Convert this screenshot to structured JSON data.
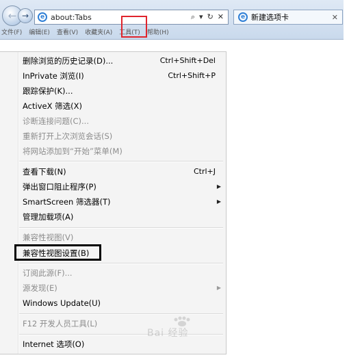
{
  "browser": {
    "address": "about:Tabs",
    "tab_title": "新建选项卡",
    "search_glyph": "⌕",
    "dropdown_glyph": "▾",
    "refresh_glyph": "↻",
    "stop_glyph": "✕",
    "tab_close_glyph": "✕",
    "back_glyph": "←",
    "forward_glyph": "→",
    "ie_glyph": "e"
  },
  "menubar": [
    {
      "label": "文件(F)"
    },
    {
      "label": "编辑(E)"
    },
    {
      "label": "查看(V)"
    },
    {
      "label": "收藏夹(A)"
    },
    {
      "label": "工具(T)"
    },
    {
      "label": "帮助(H)"
    }
  ],
  "tools_menu": {
    "items": [
      {
        "label": "删除浏览的历史记录(D)...",
        "shortcut": "Ctrl+Shift+Del"
      },
      {
        "label": "InPrivate 浏览(I)",
        "shortcut": "Ctrl+Shift+P"
      },
      {
        "label": "跟踪保护(K)..."
      },
      {
        "label": "ActiveX 筛选(X)"
      },
      {
        "label": "诊断连接问题(C)..."
      },
      {
        "label": "重新打开上次浏览会话(S)"
      },
      {
        "label": "将网站添加到“开始”菜单(M)"
      },
      {
        "label": "查看下载(N)",
        "shortcut": "Ctrl+J"
      },
      {
        "label": "弹出窗口阻止程序(P)"
      },
      {
        "label": "SmartScreen 筛选器(T)"
      },
      {
        "label": "管理加载项(A)"
      },
      {
        "label": "兼容性视图(V)"
      },
      {
        "label": "兼容性视图设置(B)"
      },
      {
        "label": "订阅此源(F)..."
      },
      {
        "label": "源发现(E)"
      },
      {
        "label": "Windows Update(U)"
      },
      {
        "label": "F12 开发人员工具(L)"
      },
      {
        "label": "Internet 选项(O)"
      }
    ],
    "submenu_glyph": "▶"
  },
  "watermark": {
    "text": "Bai 经验"
  },
  "colors": {
    "highlight_red": "#e0242c",
    "menu_bg": "#f4f4f4",
    "disabled_text": "#8c8c8c"
  }
}
